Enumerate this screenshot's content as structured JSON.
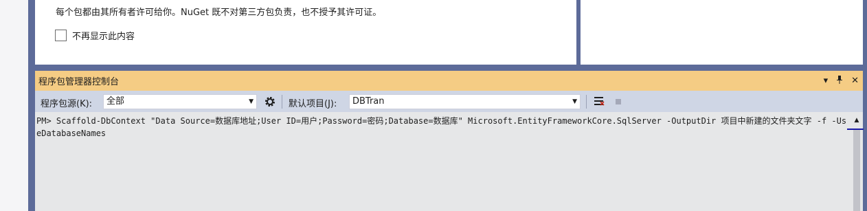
{
  "document": {
    "notice": "每个包都由其所有者许可给你。NuGet 既不对第三方包负责，也不授予其许可证。",
    "dont_show_label": "不再显示此内容"
  },
  "panel": {
    "title": "程序包管理器控制台",
    "controls": {
      "dropdown_glyph": "▾",
      "pin_glyph": "ᵽ",
      "close_glyph": "✕"
    }
  },
  "toolbar": {
    "source_label": "程序包源(K):",
    "source_value": "全部",
    "default_project_label": "默认项目(J):",
    "default_project_value": "DBTran",
    "icons": [
      "settings-gear-icon",
      "clear-console-icon",
      "stop-icon"
    ]
  },
  "console": {
    "text": "PM> Scaffold-DbContext \"Data Source=数据库地址;User ID=用户;Password=密码;Database=数据库\" Microsoft.EntityFrameworkCore.SqlServer -OutputDir 项目中新建的文件夹文字 -f -UseDatabaseNames"
  },
  "colors": {
    "frame": "#5d6b99",
    "title_bar": "#f5cc84",
    "toolbar": "#cfd6e5",
    "console_bg": "#e6e7e8"
  }
}
